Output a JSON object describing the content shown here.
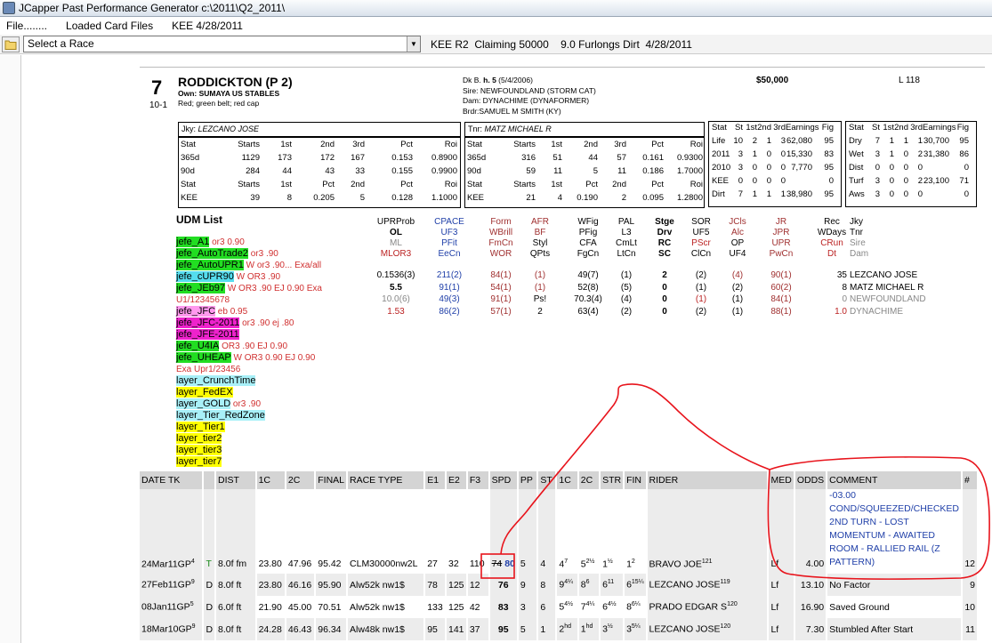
{
  "window": {
    "title": "JCapper Past Performance Generator c:\\2011\\Q2_2011\\"
  },
  "menu": [
    "File........",
    "Loaded Card Files",
    "KEE 4/28/2011"
  ],
  "race_select": {
    "value": "Select a Race"
  },
  "race_info": "KEE R2  Claiming 50000    9.0 Furlongs Dirt  4/28/2011",
  "horse": {
    "post": "7",
    "odds": "10-1",
    "name": "RODDICKTON  (P 2)",
    "owner": "Own: SUMAYA US STABLES",
    "silks": "Red; green belt; red cap",
    "breed_prefix": "Dk B. ",
    "breed_sex": "h. 5",
    "breed_dob": " (5/4/2006)",
    "sire": "Sire: NEWFOUNDLAND (STORM CAT)",
    "dam": "Dam: DYNACHIME (DYNAFORMER)",
    "breeder": "Brdr:SAMUEL M SMITH (KY)",
    "claim": "$50,000",
    "weight": "L 118"
  },
  "jockey": {
    "label": "Jky: ",
    "name": "LEZCANO JOSE",
    "rows": [
      [
        "Stat",
        "Starts",
        "1st",
        "2nd",
        "3rd",
        "Pct",
        "Roi"
      ],
      [
        "365d",
        "1129",
        "173",
        "172",
        "167",
        "0.153",
        "0.8900"
      ],
      [
        "90d",
        "284",
        "44",
        "43",
        "33",
        "0.155",
        "0.9900"
      ],
      [
        "Stat",
        "Starts",
        "1st",
        "Pct",
        "2nd",
        "Pct",
        "Roi"
      ],
      [
        "KEE",
        "39",
        "8",
        "0.205",
        "5",
        "0.128",
        "1.1000"
      ]
    ]
  },
  "trainer": {
    "label": "Tnr: ",
    "name": "MATZ MICHAEL R",
    "rows": [
      [
        "Stat",
        "Starts",
        "1st",
        "2nd",
        "3rd",
        "Pct",
        "Roi"
      ],
      [
        "365d",
        "316",
        "51",
        "44",
        "57",
        "0.161",
        "0.9300"
      ],
      [
        "90d",
        "59",
        "11",
        "5",
        "11",
        "0.186",
        "1.7000"
      ],
      [
        "Stat",
        "Starts",
        "1st",
        "Pct",
        "2nd",
        "Pct",
        "Roi"
      ],
      [
        "KEE",
        "21",
        "4",
        "0.190",
        "2",
        "0.095",
        "1.2800"
      ]
    ]
  },
  "stats1": [
    [
      "Stat",
      "St",
      "1st",
      "2nd",
      "3rd",
      "Earnings",
      "Fig"
    ],
    [
      "Life",
      "10",
      "2",
      "1",
      "3",
      "62,080",
      "95"
    ],
    [
      "2011",
      "3",
      "1",
      "0",
      "0",
      "15,330",
      "83"
    ],
    [
      "2010",
      "3",
      "0",
      "0",
      "0",
      "7,770",
      "95"
    ],
    [
      "KEE",
      "0",
      "0",
      "0",
      "0",
      "",
      "0"
    ],
    [
      "Dirt",
      "7",
      "1",
      "1",
      "1",
      "38,980",
      "95"
    ]
  ],
  "stats2": [
    [
      "Stat",
      "St",
      "1st",
      "2nd",
      "3rd",
      "Earnings",
      "Fig"
    ],
    [
      "Dry",
      "7",
      "1",
      "1",
      "1",
      "30,700",
      "95"
    ],
    [
      "Wet",
      "3",
      "1",
      "0",
      "2",
      "31,380",
      "86"
    ],
    [
      "Dist",
      "0",
      "0",
      "0",
      "0",
      "",
      "0"
    ],
    [
      "Turf",
      "3",
      "0",
      "0",
      "2",
      "23,100",
      "71"
    ],
    [
      "Aws",
      "3",
      "0",
      "0",
      "0",
      "",
      "0"
    ]
  ],
  "udm_title": "UDM List",
  "udm": [
    {
      "name": "jefe_A1",
      "hl": "green",
      "note": " or3 0.90"
    },
    {
      "name": "jefe_AutoTrade2",
      "hl": "green",
      "note": " or3 .90"
    },
    {
      "name": "jefe_AutoUPR1",
      "hl": "green",
      "note": " W or3 .90... Exa/all"
    },
    {
      "name": "jefe_cUPR90",
      "hl": "cyan",
      "note": " W OR3 .90"
    },
    {
      "name": "jefe_JEb97",
      "hl": "green",
      "note": " W OR3 .90 EJ 0.90 Exa"
    },
    {
      "name": "",
      "hl": "",
      "note": "U1/12345678"
    },
    {
      "name": "jefe_JFC",
      "hl": "pink",
      "note": " eb 0.95"
    },
    {
      "name": "jefe_JFC-2011",
      "hl": "mag",
      "note": " or3 .90 ej .80"
    },
    {
      "name": "jefe_JFE-2011",
      "hl": "mag",
      "note": ""
    },
    {
      "name": "jefe_U4IA",
      "hl": "green",
      "note": " OR3 .90 EJ 0.90"
    },
    {
      "name": "jefe_UHEAP",
      "hl": "green",
      "note": " W OR3 0.90 EJ 0.90"
    },
    {
      "name": "",
      "hl": "",
      "note": "Exa Upr1/23456"
    },
    {
      "name": "layer_CrunchTime",
      "hl": "lcyan",
      "note": ""
    },
    {
      "name": "layer_FedEX",
      "hl": "yellow",
      "note": ""
    },
    {
      "name": "layer_GOLD",
      "hl": "lcyan",
      "note": " or3 .90"
    },
    {
      "name": "layer_Tier_RedZone",
      "hl": "lcyan",
      "note": ""
    },
    {
      "name": "layer_Tier1",
      "hl": "yellow",
      "note": ""
    },
    {
      "name": "layer_tier2",
      "hl": "yellow",
      "note": ""
    },
    {
      "name": "layer_tier3",
      "hl": "yellow",
      "note": ""
    },
    {
      "name": "layer_tier7",
      "hl": "yellow",
      "note": ""
    }
  ],
  "factors": {
    "c1": {
      "h": [
        "UPRProb",
        "OL",
        "ML",
        "MLOR3"
      ],
      "v": [
        "0.1536(3)",
        "5.5",
        "10.0(6)",
        "1.53"
      ]
    },
    "c2": {
      "h": [
        "CPACE",
        "UF3",
        "PFit",
        "EeCn"
      ],
      "v": [
        "211(2)",
        "91(1)",
        "49(3)",
        "86(2)"
      ]
    },
    "c3": {
      "h": [
        "Form",
        "WBrill",
        "FmCn",
        "WOR"
      ],
      "v": [
        "84(1)",
        "54(1)",
        "91(1)",
        "57(1)"
      ]
    },
    "c4": {
      "h": [
        "AFR",
        "BF",
        "Styl",
        "QPts"
      ],
      "v": [
        "(1)",
        "(1)",
        "Ps!",
        "2"
      ]
    },
    "c5": {
      "h": [
        "WFig",
        "PFig",
        "CFA",
        "FgCn"
      ],
      "v": [
        "49(7)",
        "52(8)",
        "70.3(4)",
        "63(4)"
      ]
    },
    "c6": {
      "h": [
        "PAL",
        "L3",
        "CmLt",
        "LtCn"
      ],
      "v": [
        "(1)",
        "(5)",
        "(4)",
        "(2)"
      ]
    },
    "c7": {
      "h": [
        "Stge",
        "Drv",
        "RC",
        "SC"
      ],
      "v": [
        "2",
        "0",
        "0",
        "0"
      ]
    },
    "c8": {
      "h": [
        "SOR",
        "UF5",
        "PScr",
        "ClCn"
      ],
      "v": [
        "(2)",
        "(1)",
        "(1)",
        "(2)"
      ]
    },
    "c9": {
      "h": [
        "JCls",
        "Alc",
        "OP",
        "UF4"
      ],
      "v": [
        "(4)",
        "(2)",
        "(1)",
        "(1)"
      ]
    },
    "c10": {
      "h": [
        "JR",
        "JPR",
        "UPR",
        "PwCn"
      ],
      "v": [
        "90(1)",
        "60(2)",
        "84(1)",
        "88(1)"
      ]
    },
    "c11": {
      "h": [
        "Rec",
        "WDays",
        "CRun",
        "Dt"
      ],
      "v": [
        "35",
        "8",
        "0",
        "1.0"
      ]
    },
    "c12": {
      "h": [
        "Jky",
        "Tnr",
        "Sire",
        "Dam"
      ],
      "v": [
        "LEZCANO JOSE",
        "MATZ MICHAEL R",
        "NEWFOUNDLAND",
        "DYNACHIME"
      ]
    }
  },
  "pp": {
    "headers": [
      "DATE TK",
      "",
      "DIST",
      "1C",
      "2C",
      "FINAL",
      "RACE TYPE",
      "E1",
      "E2",
      "F3",
      "SPD",
      "PP",
      "ST",
      "1C",
      "2C",
      "STR",
      "FIN",
      "RIDER",
      "MED",
      "ODDS",
      "COMMENT",
      "#"
    ],
    "rows": [
      {
        "date": "24Mar11GP",
        "dsup": "4",
        "surf": "T",
        "dist": "8.0f fm",
        "c1": "23.80",
        "c2": "47.96",
        "final": "95.42",
        "type": "CLM30000nw2L",
        "e1": "27",
        "e2": "32",
        "f3": "110",
        "spd_old": "74",
        "spd": "80",
        "pp": "5",
        "st": "4",
        "p1": "4",
        "p1s": "7",
        "p2": "5",
        "p2s": "2½",
        "str": "1",
        "strs": "½",
        "fin": "1",
        "fins": "2",
        "rider": "BRAVO JOE",
        "rsup": "121",
        "med": "Lf",
        "odds": "4.00",
        "comment": "-03.00 COND/SQUEEZED/CHECKED 2ND TURN - LOST MOMENTUM - AWAITED ROOM - RALLIED RAIL (Z PATTERN)",
        "num": "12"
      },
      {
        "date": "27Feb11GP",
        "dsup": "9",
        "surf": "D",
        "dist": "8.0f ft",
        "c1": "23.80",
        "c2": "46.16",
        "final": "95.90",
        "type": "Alw52k nw1$",
        "e1": "78",
        "e2": "125",
        "f3": "12",
        "spd": "76",
        "pp": "9",
        "st": "8",
        "p1": "9",
        "p1s": "4¼",
        "p2": "8",
        "p2s": "6",
        "str": "6",
        "strs": "11",
        "fin": "6",
        "fins": "15¼",
        "rider": "LEZCANO JOSE",
        "rsup": "119",
        "med": "Lf",
        "odds": "13.10",
        "comment": "No Factor",
        "num": "9"
      },
      {
        "date": "08Jan11GP",
        "dsup": "5",
        "surf": "D",
        "dist": "6.0f ft",
        "c1": "21.90",
        "c2": "45.00",
        "final": "70.51",
        "type": "Alw52k nw1$",
        "e1": "133",
        "e2": "125",
        "f3": "42",
        "spd": "83",
        "pp": "3",
        "st": "6",
        "p1": "5",
        "p1s": "4½",
        "p2": "7",
        "p2s": "4¼",
        "str": "6",
        "strs": "4½",
        "fin": "8",
        "fins": "6¼",
        "rider": "PRADO EDGAR S",
        "rsup": "120",
        "med": "Lf",
        "odds": "16.90",
        "comment": "Saved Ground",
        "num": "10"
      },
      {
        "date": "18Mar10GP",
        "dsup": "9",
        "surf": "D",
        "dist": "8.0f ft",
        "c1": "24.28",
        "c2": "46.43",
        "final": "96.34",
        "type": "Alw48k nw1$",
        "e1": "95",
        "e2": "141",
        "f3": "37",
        "spd": "95",
        "pp": "5",
        "st": "1",
        "p1": "2",
        "p1s": "hd",
        "p2": "1",
        "p2s": "hd",
        "str": "3",
        "strs": "½",
        "fin": "3",
        "fins": "5¼",
        "rider": "LEZCANO JOSE",
        "rsup": "120",
        "med": "Lf",
        "odds": "7.30",
        "comment": "Stumbled After Start",
        "num": "11"
      }
    ]
  },
  "colors": {
    "annotation": "#e8141c",
    "udm_note": "#d03030"
  }
}
